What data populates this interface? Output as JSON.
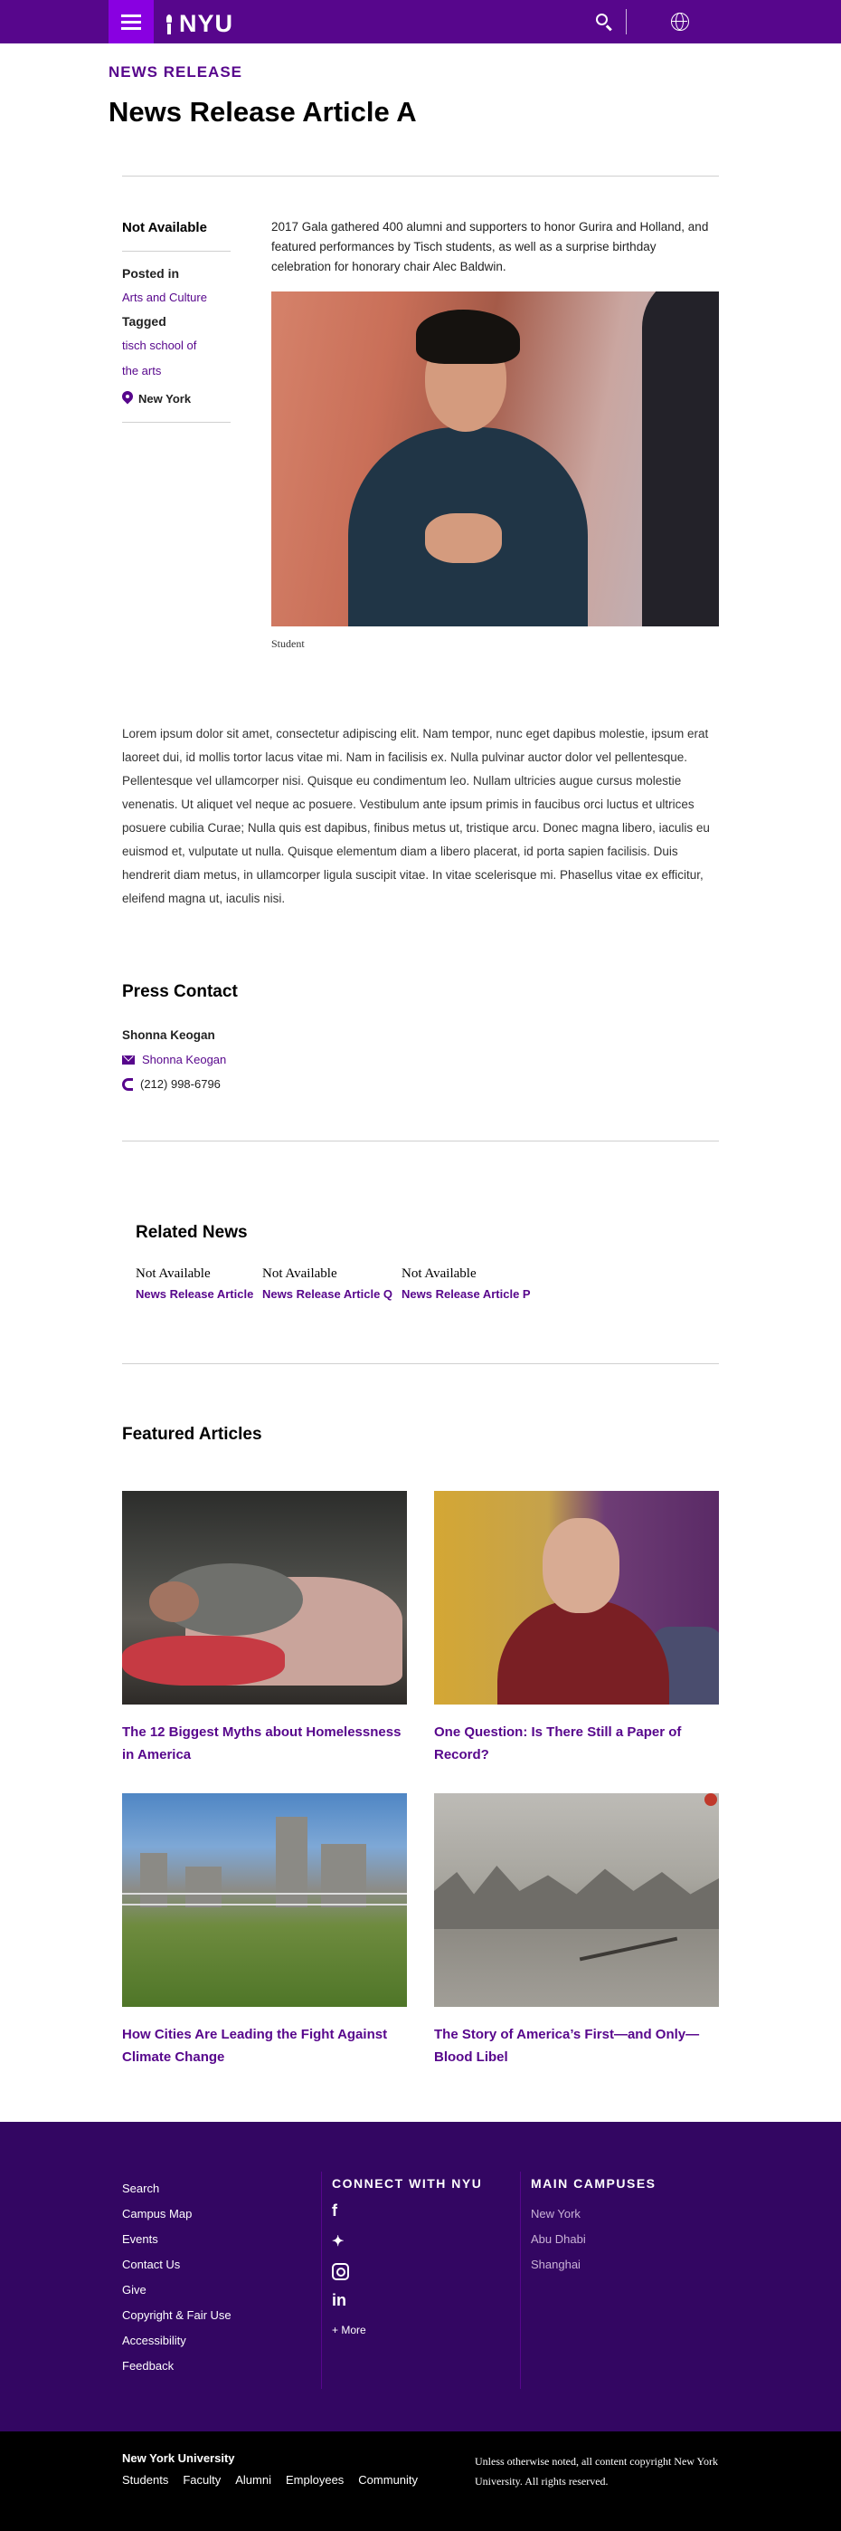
{
  "header": {
    "menu_icon": "hamburger-menu-icon",
    "logo_text": "NYU",
    "search_icon": "search-icon",
    "language_icon": "globe-icon"
  },
  "article": {
    "eyebrow": "News Release",
    "title": "News Release Article A",
    "date": "Not Available",
    "posted_in_label": "Posted in",
    "category": "Arts and Culture",
    "tagged_label": "Tagged",
    "tags": [
      "tisch school of",
      "the arts"
    ],
    "location": "New York",
    "intro": "2017 Gala gathered 400 alumni and supporters to honor Gurira and Holland, and featured performances by Tisch students, as well as a surprise birthday celebration for honorary chair Alec Baldwin.",
    "image_caption": "Student",
    "body": "Lorem ipsum dolor sit amet, consectetur adipiscing elit. Nam tempor, nunc eget dapibus molestie, ipsum erat laoreet dui, id mollis tortor lacus vitae mi. Nam in facilisis ex. Nulla pulvinar auctor dolor vel pellentesque. Pellentesque vel ullamcorper nisi. Quisque eu condimentum leo. Nullam ultricies augue cursus molestie venenatis. Ut aliquet vel neque ac posuere. Vestibulum ante ipsum primis in faucibus orci luctus et ultrices posuere cubilia Curae; Nulla quis est dapibus, finibus metus ut, tristique arcu. Donec magna libero, iaculis eu euismod et, vulputate ut nulla. Quisque elementum diam a libero placerat, id porta sapien facilisis. Duis hendrerit diam metus, in ullamcorper ligula suscipit vitae. In vitae scelerisque mi. Phasellus vitae ex efficitur, eleifend magna ut, iaculis nisi."
  },
  "press_contact": {
    "heading": "Press Contact",
    "name": "Shonna Keogan",
    "email_label": "Shonna Keogan",
    "phone": "(212) 998-6796"
  },
  "related": {
    "heading": "Related News",
    "items": [
      {
        "date": "Not Available",
        "title": "News Release Article"
      },
      {
        "date": "Not Available",
        "title": "News Release Article Q"
      },
      {
        "date": "Not Available",
        "title": "News Release Article P"
      }
    ]
  },
  "featured": {
    "heading": "Featured Articles",
    "items": [
      {
        "title": "The 12 Biggest Myths about Homelessness in America"
      },
      {
        "title": "One Question: Is There Still a Paper of Record?"
      },
      {
        "title": "How Cities Are Leading the Fight Against Climate Change"
      },
      {
        "title": "The Story of America’s First—and Only—Blood Libel"
      }
    ]
  },
  "footer": {
    "links": [
      "Search",
      "Campus Map",
      "Events",
      "Contact Us",
      "Give",
      "Copyright & Fair Use",
      "Accessibility",
      "Feedback"
    ],
    "connect_heading": "Connect with NYU",
    "social_icons": [
      "facebook-icon",
      "twitter-icon",
      "instagram-icon",
      "linkedin-icon"
    ],
    "more_label": "+ More",
    "campuses_heading": "Main Campuses",
    "campuses": [
      "New York",
      "Abu Dhabi",
      "Shanghai"
    ],
    "brand": "New York University",
    "bottom_nav": [
      "Students",
      "Faculty",
      "Alumni",
      "Employees",
      "Community"
    ],
    "copyright": "Unless otherwise noted, all content copyright New York University. All rights reserved."
  },
  "colors": {
    "brand_purple": "#57068c",
    "accent_purple": "#8900e1",
    "footer_purple": "#330662"
  }
}
